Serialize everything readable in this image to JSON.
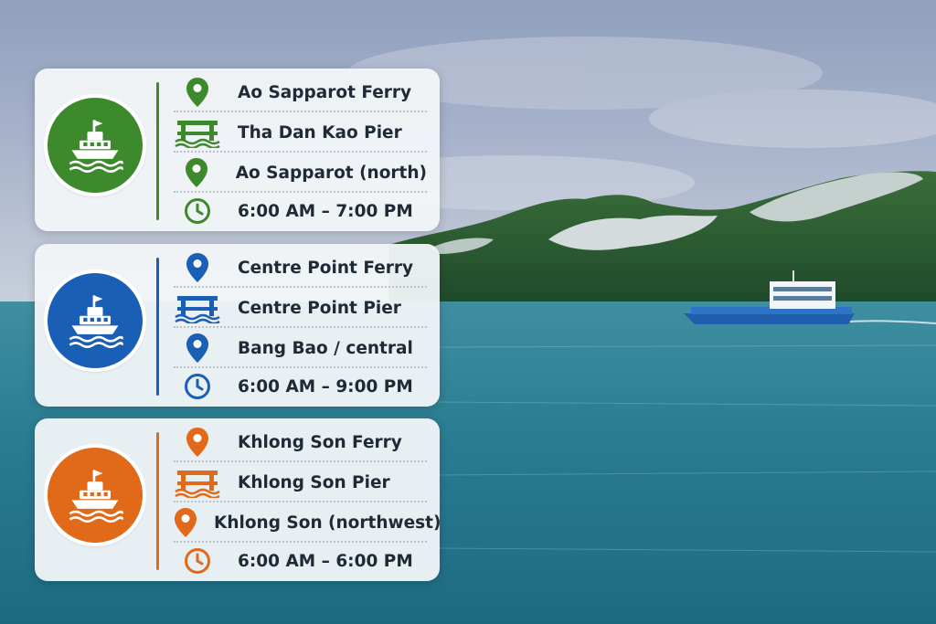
{
  "colors": {
    "green": "#3c8a2c",
    "blue": "#1a5fb6",
    "orange": "#e06a19"
  },
  "cards": [
    {
      "accent": "green",
      "ferry": "Ao Sapparot Ferry",
      "pier": "Tha Dan Kao Pier",
      "area": "Ao Sapparot (north)",
      "hours": "6:00 AM – 7:00 PM",
      "icons": [
        "ferry-icon",
        "location-pin-icon",
        "pier-icon",
        "location-pin-icon",
        "clock-icon"
      ]
    },
    {
      "accent": "blue",
      "ferry": "Centre Point Ferry",
      "pier": "Centre Point Pier",
      "area": "Bang Bao / central",
      "hours": "6:00 AM – 9:00 PM",
      "icons": [
        "ferry-icon",
        "location-pin-icon",
        "pier-icon",
        "location-pin-icon",
        "clock-icon"
      ]
    },
    {
      "accent": "orange",
      "ferry": "Khlong Son Ferry",
      "pier": "Khlong Son Pier",
      "area": "Khlong Son (northwest)",
      "hours": "6:00 AM – 6:00 PM",
      "icons": [
        "ferry-icon",
        "location-pin-icon",
        "pier-icon",
        "location-pin-icon",
        "clock-icon"
      ]
    }
  ]
}
